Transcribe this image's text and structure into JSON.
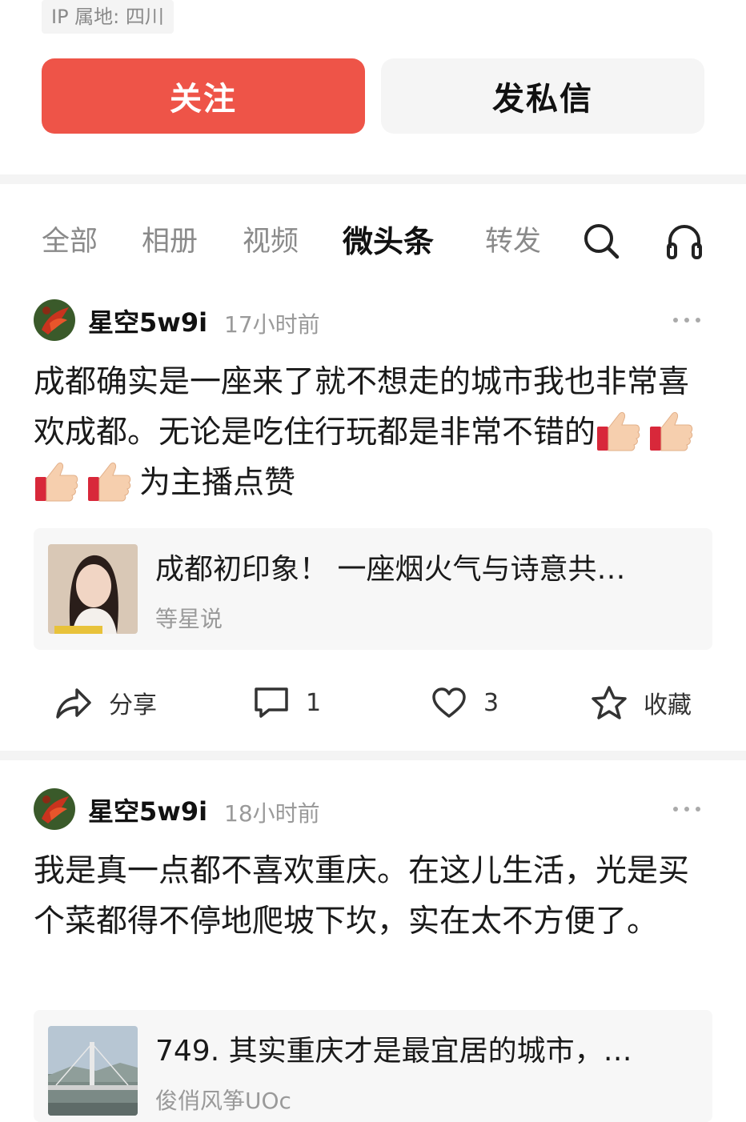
{
  "profile": {
    "ip_location": "IP 属地: 四川",
    "follow_label": "关注",
    "message_label": "发私信"
  },
  "tabs": [
    {
      "label": "全部"
    },
    {
      "label": "相册"
    },
    {
      "label": "视频"
    },
    {
      "label": "微头条"
    },
    {
      "label": "转发"
    }
  ],
  "active_tab": "微头条",
  "icons": {
    "search": "search-icon",
    "listen": "headphones-icon"
  },
  "posts": [
    {
      "author": "星空5w9i",
      "time": "17小时前",
      "text_before_emoji": "成都确实是一座来了就不想走的城市我也非常喜欢成都。无论是吃住行玩都是非常不错的",
      "text_after_emoji": "为主播点赞",
      "emoji_count": 4,
      "card": {
        "title": "成都初印象！ 一座烟火气与诗意共…",
        "source": "等星说"
      },
      "actions": {
        "share": "分享",
        "comments": "1",
        "likes": "3",
        "favorite": "收藏"
      }
    },
    {
      "author": "星空5w9i",
      "time": "18小时前",
      "text": "我是真一点都不喜欢重庆。在这儿生活，光是买个菜都得不停地爬坡下坎，实在太不方便了。",
      "card": {
        "title": "749. 其实重庆才是最宜居的城市，…",
        "source": "俊俏风筝UOc"
      }
    }
  ],
  "colors": {
    "accent": "#ee5448",
    "muted": "#8a8a8a",
    "bg_gray": "#f4f4f4"
  }
}
